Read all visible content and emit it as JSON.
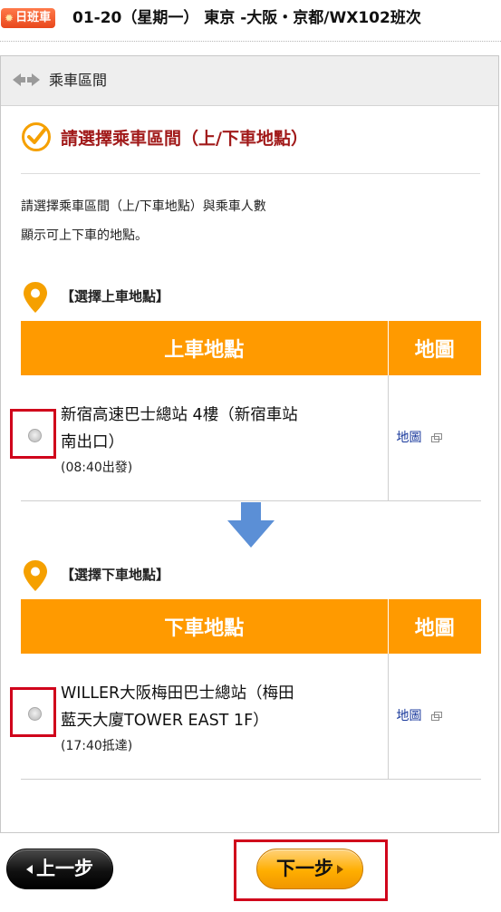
{
  "header": {
    "badge_icon": "sun-icon",
    "badge_label": "日班車",
    "trip_title": "01-20（星期一） 東京 -大阪・京都/WX102班次"
  },
  "panel": {
    "title": "乘車區間",
    "title_icon": "left-right-arrows-icon",
    "heading": "請選擇乘車區間（上/下車地點）",
    "heading_icon": "check-circle-icon",
    "description_line1": "請選擇乘車區間（上/下車地點）與乘車人數",
    "description_line2": "顯示可上下車的地點。"
  },
  "boarding": {
    "section_label": "【選擇上車地點】",
    "col_location": "上車地點",
    "col_map": "地圖",
    "stop_line1": "新宿高速巴士總站 4樓（新宿車站",
    "stop_line2": "南出口）",
    "time": "(08:40出發)",
    "map_link": "地圖"
  },
  "alighting": {
    "section_label": "【選擇下車地點】",
    "col_location": "下車地點",
    "col_map": "地圖",
    "stop_line1": "WILLER大阪梅田巴士總站（梅田",
    "stop_line2": "藍天大廈TOWER EAST 1F）",
    "time": "(17:40抵達)",
    "map_link": "地圖"
  },
  "buttons": {
    "prev": "上一步",
    "next": "下一步"
  },
  "colors": {
    "accent_orange": "#ff9a00",
    "heading_red": "#a11a1a",
    "highlight_red": "#d0021b",
    "arrow_blue": "#5b8fd6"
  }
}
